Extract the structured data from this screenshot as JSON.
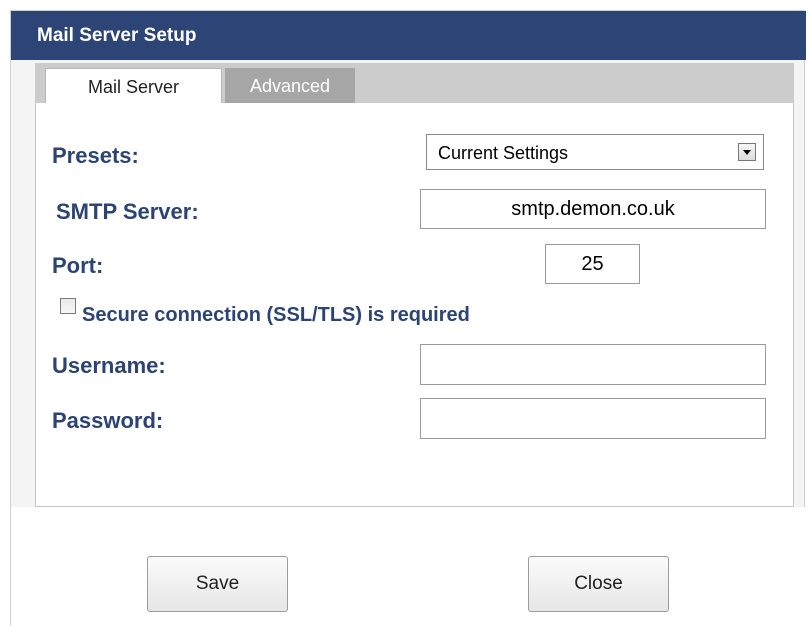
{
  "window": {
    "title": "Mail Server Setup"
  },
  "tabs": [
    {
      "label": "Mail Server",
      "active": true
    },
    {
      "label": "Advanced",
      "active": false
    }
  ],
  "form": {
    "presets_label": "Presets:",
    "presets_value": "Current Settings",
    "smtp_label": "SMTP Server:",
    "smtp_value": "smtp.demon.co.uk",
    "port_label": "Port:",
    "port_value": "25",
    "ssl_label": "Secure connection (SSL/TLS) is required",
    "ssl_checked": false,
    "username_label": "Username:",
    "username_value": "",
    "password_label": "Password:",
    "password_value": ""
  },
  "buttons": {
    "save": "Save",
    "close": "Close"
  },
  "colors": {
    "titlebar": "#2d4576",
    "label": "#2b4474",
    "inactive_tab": "#a6a6a6"
  }
}
